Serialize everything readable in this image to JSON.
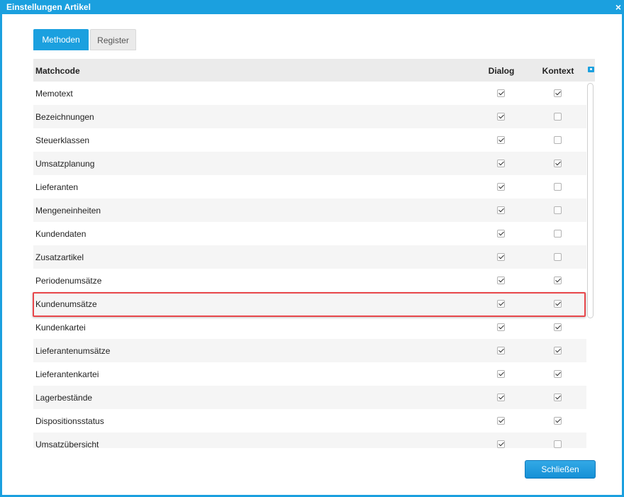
{
  "window": {
    "title": "Einstellungen Artikel",
    "close_glyph": "×"
  },
  "tabs": [
    {
      "label": "Methoden",
      "active": true
    },
    {
      "label": "Register",
      "active": false
    }
  ],
  "grid": {
    "columns": {
      "matchcode": "Matchcode",
      "dialog": "Dialog",
      "kontext": "Kontext",
      "config_icon": "column-chooser-icon"
    },
    "rows": [
      {
        "label": "Memotext",
        "dialog": true,
        "kontext": true
      },
      {
        "label": "Bezeichnungen",
        "dialog": true,
        "kontext": false
      },
      {
        "label": "Steuerklassen",
        "dialog": true,
        "kontext": false
      },
      {
        "label": "Umsatzplanung",
        "dialog": true,
        "kontext": true
      },
      {
        "label": "Lieferanten",
        "dialog": true,
        "kontext": false
      },
      {
        "label": "Mengeneinheiten",
        "dialog": true,
        "kontext": false
      },
      {
        "label": "Kundendaten",
        "dialog": true,
        "kontext": false
      },
      {
        "label": "Zusatzartikel",
        "dialog": true,
        "kontext": false
      },
      {
        "label": "Periodenumsätze",
        "dialog": true,
        "kontext": true
      },
      {
        "label": "Kundenumsätze",
        "dialog": true,
        "kontext": true
      },
      {
        "label": "Kundenkartei",
        "dialog": true,
        "kontext": true
      },
      {
        "label": "Lieferantenumsätze",
        "dialog": true,
        "kontext": true
      },
      {
        "label": "Lieferantenkartei",
        "dialog": true,
        "kontext": true
      },
      {
        "label": "Lagerbestände",
        "dialog": true,
        "kontext": true
      },
      {
        "label": "Dispositionsstatus",
        "dialog": true,
        "kontext": true
      },
      {
        "label": "Umsatzübersicht",
        "dialog": true,
        "kontext": false
      }
    ]
  },
  "footer": {
    "close_button": "Schließen"
  },
  "colors": {
    "accent": "#1ba0df",
    "highlight": "#e8474b"
  }
}
